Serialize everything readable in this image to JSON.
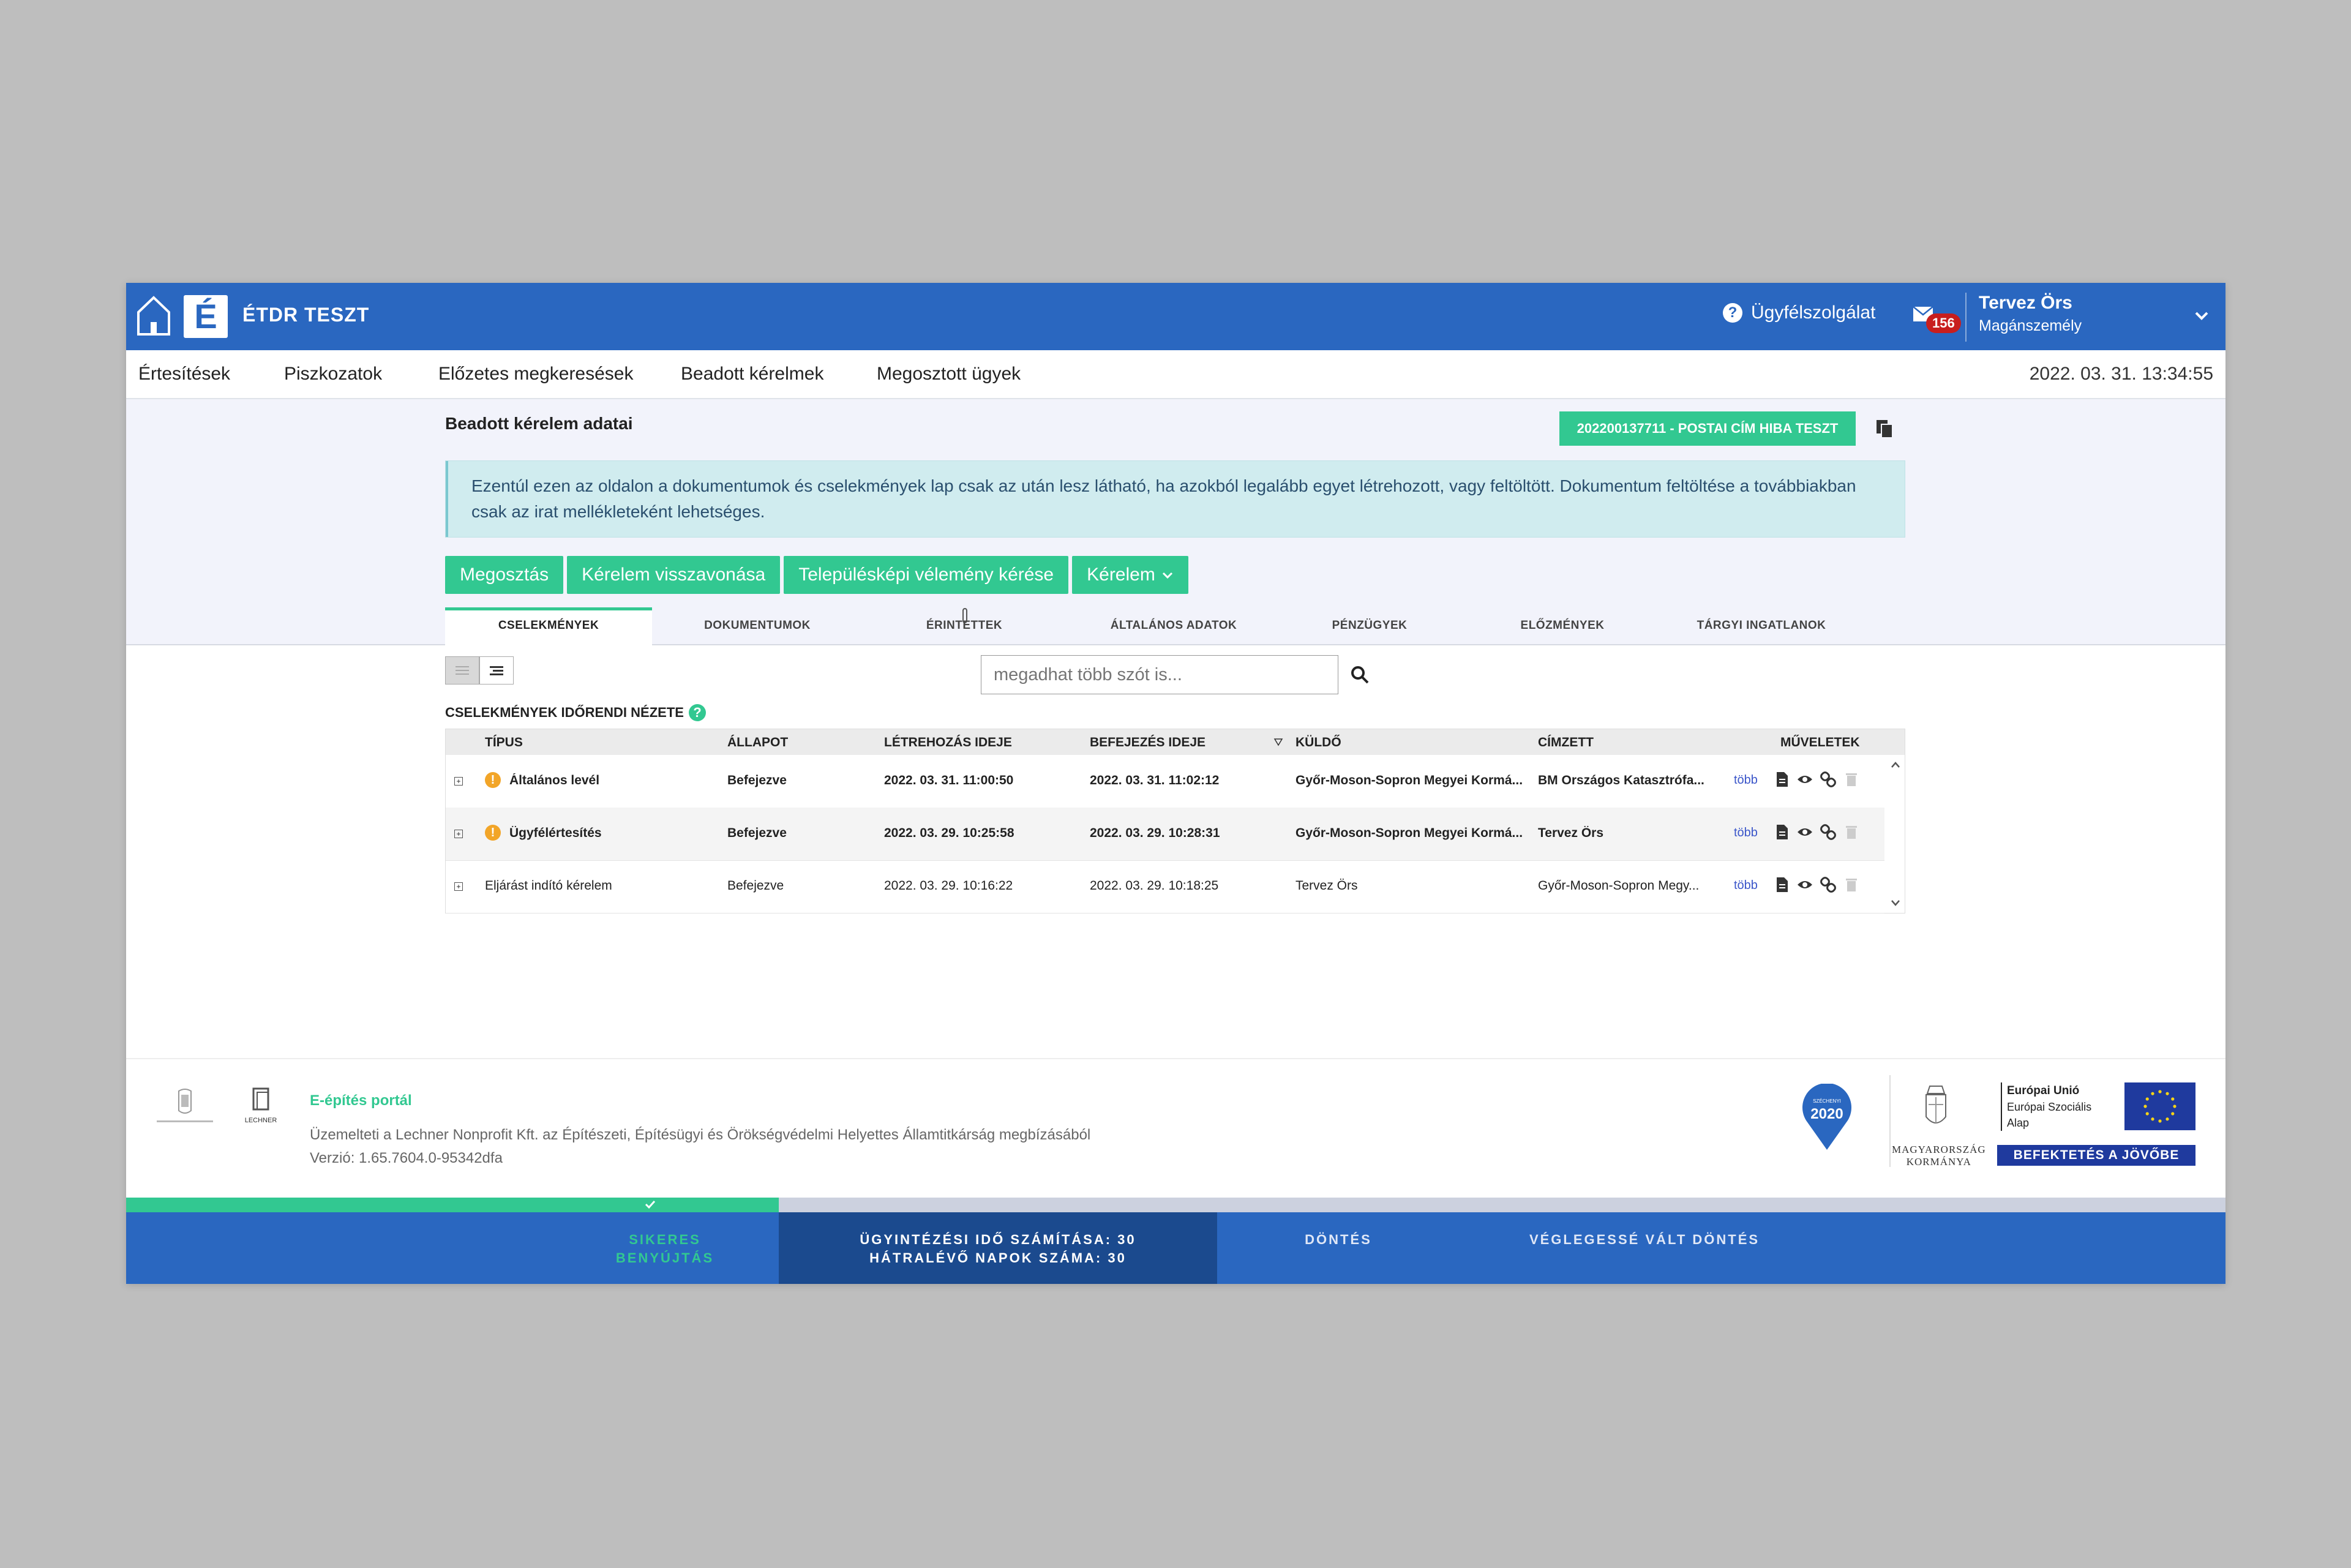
{
  "header": {
    "title": "ÉTDR TESZT",
    "logo_letter": "É",
    "help_label": "Ügyfélszolgálat",
    "mail_count": "156",
    "user_name": "Tervez Örs",
    "user_role": "Magánszemély"
  },
  "nav": {
    "items": [
      "Értesítések",
      "Piszkozatok",
      "Előzetes megkeresések",
      "Beadott kérelmek",
      "Megosztott ügyek"
    ],
    "clock": "2022. 03. 31. 13:34:55"
  },
  "page": {
    "title": "Beadott kérelem adatai",
    "case_button": "202200137711 - POSTAI CÍM HIBA TESZT",
    "info": "Ezentúl ezen az oldalon a dokumentumok és cselekmények lap csak az után lesz látható, ha azokból legalább egyet létrehozott, vagy feltöltött. Dokumentum feltöltése a továbbiakban csak az irat mellékleteként lehetséges."
  },
  "actions": [
    "Megosztás",
    "Kérelem visszavonása",
    "Településképi vélemény kérése",
    "Kérelem"
  ],
  "tabs": [
    "CSELEKMÉNYEK",
    "DOKUMENTUMOK",
    "ÉRINTETTEK",
    "ÁLTALÁNOS ADATOK",
    "PÉNZÜGYEK",
    "ELŐZMÉNYEK",
    "TÁRGYI INGATLANOK"
  ],
  "search": {
    "placeholder": "megadhat több szót is..."
  },
  "list": {
    "title": "CSELEKMÉNYEK IDŐRENDI NÉZETE",
    "columns": [
      "TÍPUS",
      "ÁLLAPOT",
      "LÉTREHOZÁS IDEJE",
      "BEFEJEZÉS IDEJE",
      "KÜLDŐ",
      "CÍMZETT",
      "MŰVELETEK"
    ],
    "more_label": "több",
    "rows": [
      {
        "type": "Általános levél",
        "status": "Befejezve",
        "created": "2022. 03. 31. 11:00:50",
        "finished": "2022. 03. 31. 11:02:12",
        "sender": "Győr-Moson-Sopron Megyei Kormá...",
        "recipient": "BM Országos Katasztrófa..."
      },
      {
        "type": "Ügyfélértesítés",
        "status": "Befejezve",
        "created": "2022. 03. 29. 10:25:58",
        "finished": "2022. 03. 29. 10:28:31",
        "sender": "Győr-Moson-Sopron Megyei Kormá...",
        "recipient": "Tervez Örs"
      },
      {
        "type": "Eljárást indító kérelem",
        "status": "Befejezve",
        "created": "2022. 03. 29. 10:16:22",
        "finished": "2022. 03. 29. 10:18:25",
        "sender": "Tervez Örs",
        "recipient": "Győr-Moson-Sopron Megy..."
      }
    ]
  },
  "footer": {
    "portal": "E-építés portál",
    "operator": "Üzemelteti a Lechner Nonprofit Kft. az Építészeti, Építésügyi és Örökségvédelmi Helyettes Államtitkárság megbízásából",
    "version": "Verzió: 1.65.7604.0-95342dfa",
    "lechner": "LECHNER",
    "szechenyi_small": "SZÉCHENYI",
    "szechenyi_year": "2020",
    "gov_line1": "MAGYARORSZÁG",
    "gov_line2": "KORMÁNYA",
    "eu_line1": "Európai Unió",
    "eu_line2": "Európai Szociális",
    "eu_line3": "Alap",
    "eu_slogan": "BEFEKTETÉS A JÖVŐBE"
  },
  "progress": {
    "done_fraction": 0.311,
    "steps": [
      {
        "line1": "SIKERES",
        "line2": "BENYÚJTÁS"
      },
      {
        "line1": "ÜGYINTÉZÉSI IDŐ SZÁMÍTÁSA: 30",
        "line2": "HÁTRALÉVŐ NAPOK SZÁMA: 30"
      },
      {
        "line1": "DÖNTÉS",
        "line2": ""
      },
      {
        "line1": "VÉGLEGESSÉ VÁLT DÖNTÉS",
        "line2": ""
      }
    ]
  },
  "colors": {
    "brand_blue": "#2a67c0",
    "accent_green": "#32c891",
    "info_bg": "#d0ecef",
    "badge_red": "#c81e1e"
  }
}
